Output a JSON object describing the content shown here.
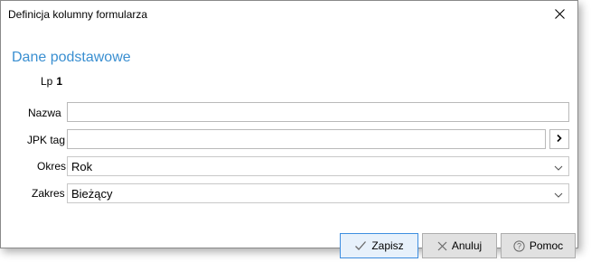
{
  "window": {
    "title": "Definicja kolumny formularza",
    "close_glyph": "✕"
  },
  "section": {
    "title": "Dane podstawowe"
  },
  "lp": {
    "label": "Lp",
    "value": "1"
  },
  "fields": {
    "nazwa": {
      "label": "Nazwa",
      "value": "",
      "placeholder": ""
    },
    "jpk_tag": {
      "label": "JPK tag",
      "value": "",
      "placeholder": "",
      "button_glyph": ">"
    },
    "okres": {
      "label": "Okres",
      "value": "Rok"
    },
    "zakres": {
      "label": "Zakres",
      "value": "Bieżący"
    }
  },
  "buttons": {
    "save": {
      "label": "Zapisz",
      "icon": "check-icon"
    },
    "cancel": {
      "label": "Anuluj",
      "icon": "x-icon"
    },
    "help": {
      "label": "Pomoc",
      "icon": "question-circle-icon"
    }
  },
  "colors": {
    "section_title": "#3a8fd1",
    "primary_button_border": "#3d8ee0"
  }
}
